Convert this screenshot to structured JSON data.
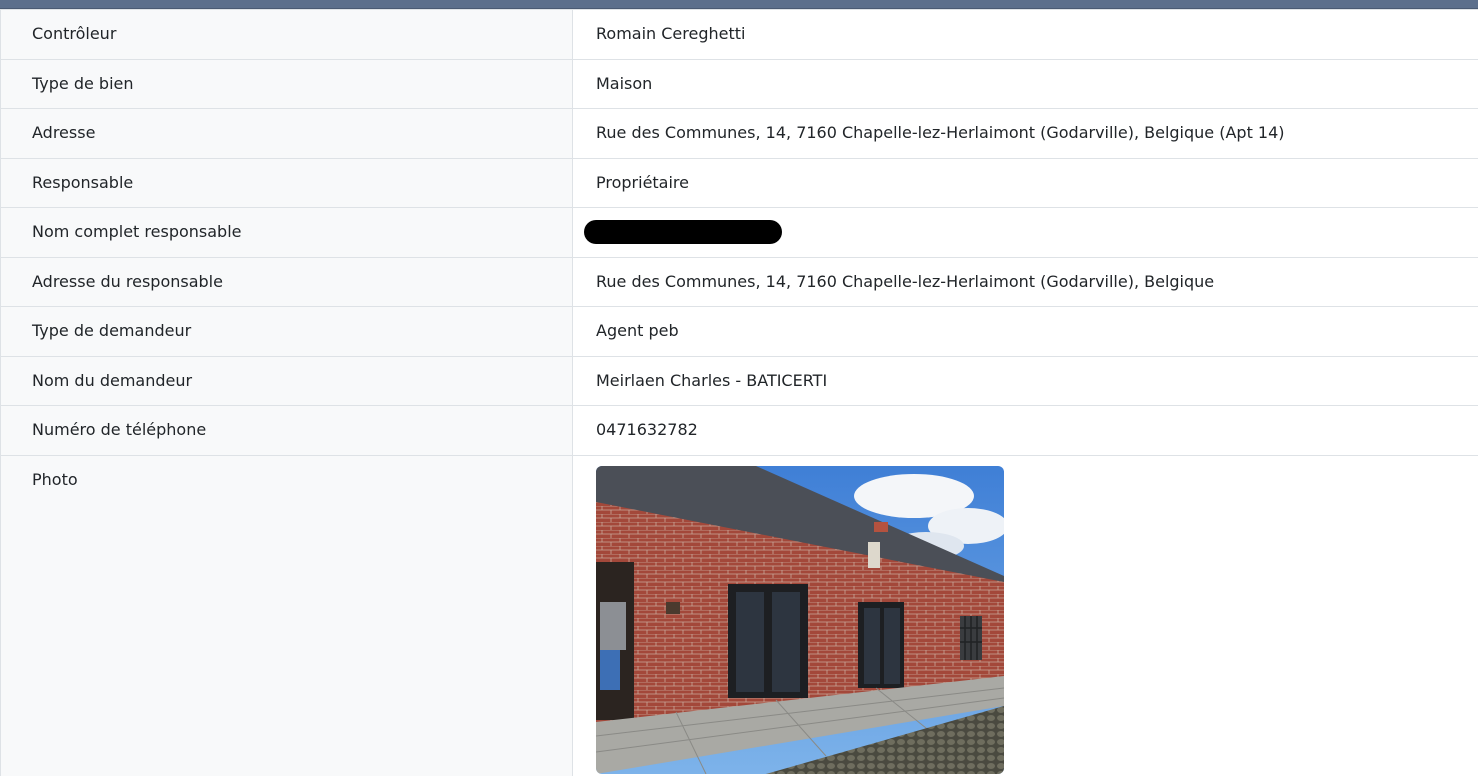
{
  "rows": [
    {
      "label": "Contrôleur",
      "value": "Romain Cereghetti"
    },
    {
      "label": "Type de bien",
      "value": "Maison"
    },
    {
      "label": "Adresse",
      "value": "Rue des Communes, 14, 7160 Chapelle-lez-Herlaimont (Godarville), Belgique (Apt 14)"
    },
    {
      "label": "Responsable",
      "value": "Propriétaire"
    },
    {
      "label": "Nom complet responsable",
      "value": ""
    },
    {
      "label": "Adresse du responsable",
      "value": "Rue des Communes, 14, 7160 Chapelle-lez-Herlaimont (Godarville), Belgique"
    },
    {
      "label": "Type de demandeur",
      "value": "Agent peb"
    },
    {
      "label": "Nom du demandeur",
      "value": "Meirlaen Charles - BATICERTI"
    },
    {
      "label": "Numéro de téléphone",
      "value": "0471632782"
    },
    {
      "label": "Photo",
      "value": ""
    }
  ],
  "colors": {
    "header_bar": "#5c6f8c",
    "label_bg": "#f8f9fa",
    "border": "#dee2e6",
    "redaction": "#000000"
  }
}
